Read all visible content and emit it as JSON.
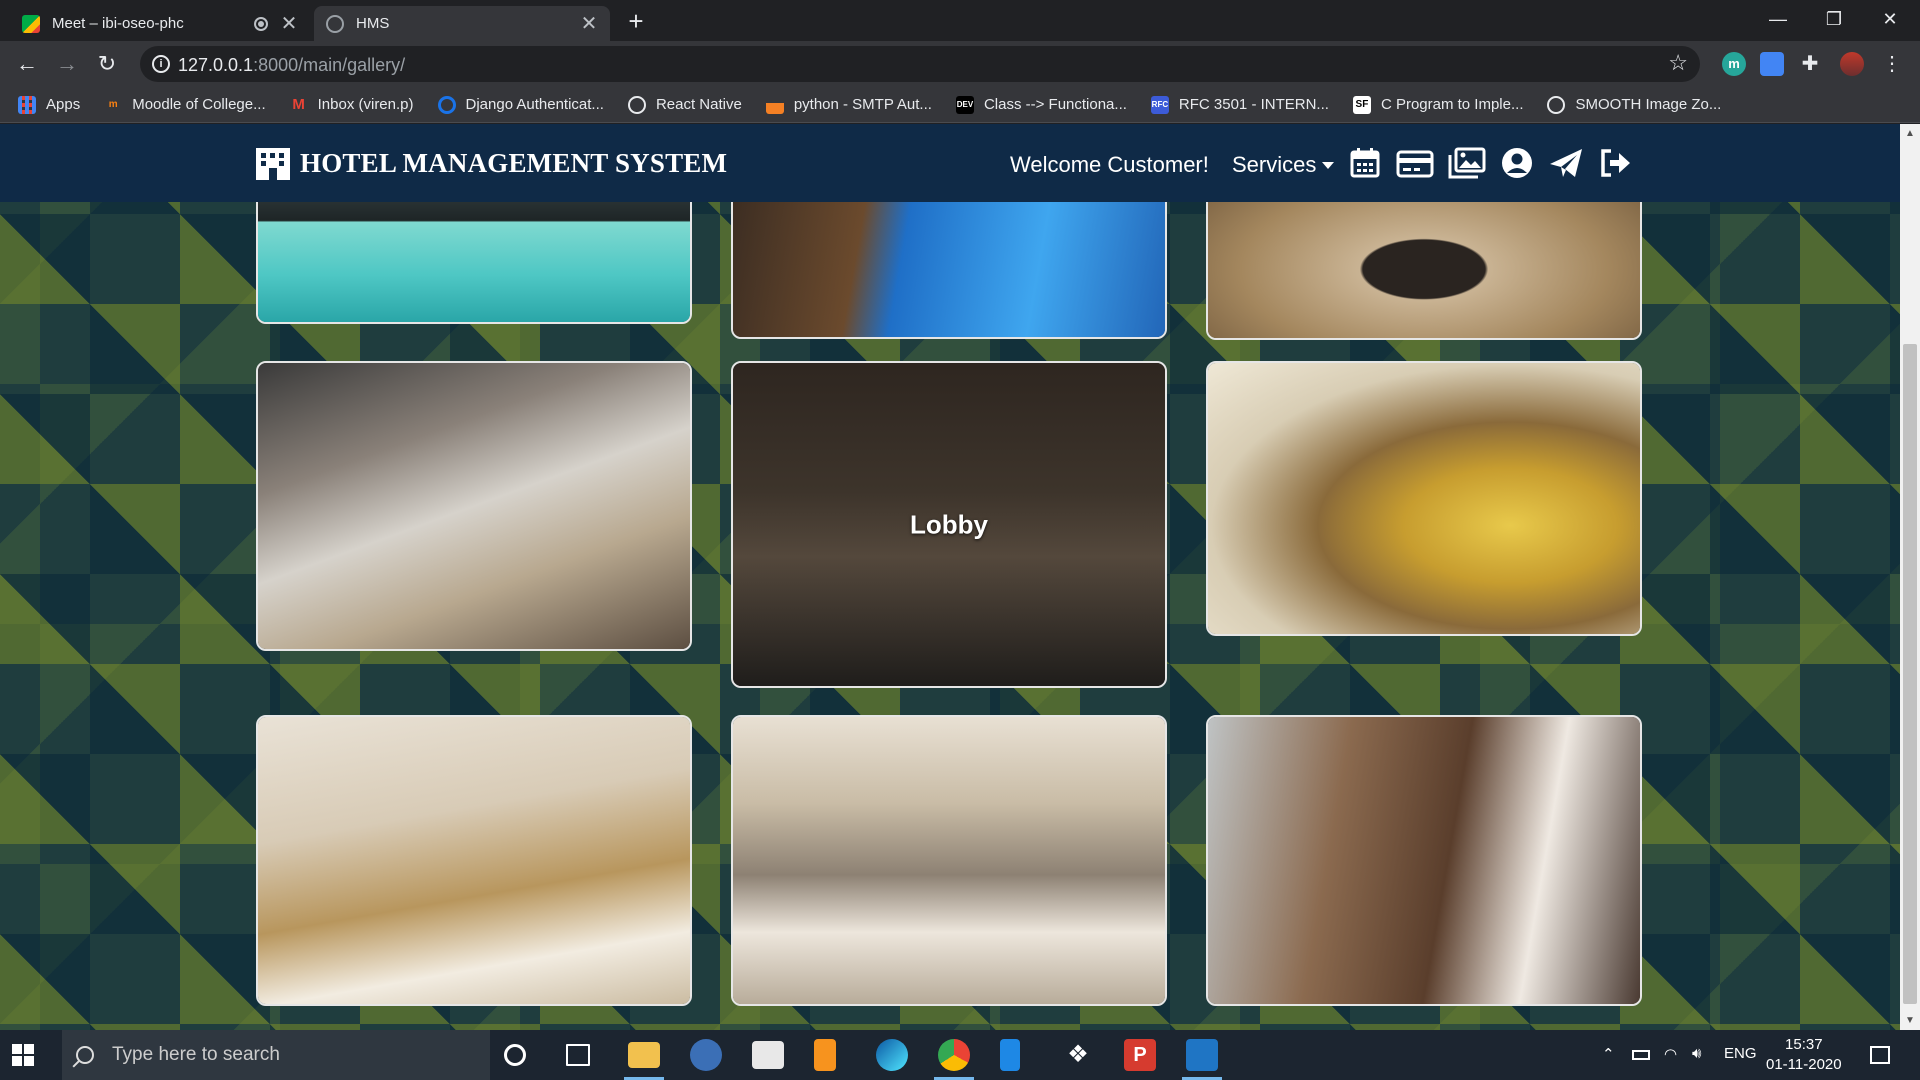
{
  "browser": {
    "tabs": [
      {
        "title": "Meet – ibi-oseo-phc",
        "active": false
      },
      {
        "title": "HMS",
        "active": true
      }
    ],
    "url_host": "127.0.0.1",
    "url_path": ":8000/main/gallery/",
    "bookmarks": [
      {
        "label": "Apps",
        "icon": "apps-grid-icon"
      },
      {
        "label": "Moodle of College...",
        "icon": "moodle-icon"
      },
      {
        "label": "Inbox (viren.p)",
        "icon": "gmail-icon"
      },
      {
        "label": "Django Authenticat...",
        "icon": "django-icon"
      },
      {
        "label": "React Native",
        "icon": "globe-icon"
      },
      {
        "label": "python - SMTP Aut...",
        "icon": "stackoverflow-icon"
      },
      {
        "label": "Class --> Functiona...",
        "icon": "dev-icon"
      },
      {
        "label": "RFC 3501 - INTERN...",
        "icon": "rfc-icon"
      },
      {
        "label": "C Program to Imple...",
        "icon": "sf-icon"
      },
      {
        "label": "SMOOTH Image Zo...",
        "icon": "globe-icon"
      }
    ]
  },
  "app": {
    "brand": "HOTEL MANAGEMENT SYSTEM",
    "welcome": "Welcome Customer!",
    "services_label": "Services",
    "nav_icons": [
      "calendar-icon",
      "credit-card-icon",
      "gallery-icon",
      "user-circle-icon",
      "paper-plane-icon",
      "logout-icon"
    ],
    "navbar_color": "#0f2a47"
  },
  "gallery": {
    "items": [
      {
        "name": "pool-1",
        "caption": ""
      },
      {
        "name": "pool-2",
        "caption": ""
      },
      {
        "name": "dining-hall",
        "caption": ""
      },
      {
        "name": "buffet",
        "caption": ""
      },
      {
        "name": "lobby",
        "caption": "Lobby"
      },
      {
        "name": "reception",
        "caption": ""
      },
      {
        "name": "bedroom-1",
        "caption": ""
      },
      {
        "name": "bedroom-2",
        "caption": ""
      },
      {
        "name": "bedroom-3",
        "caption": ""
      }
    ]
  },
  "taskbar": {
    "search_placeholder": "Type here to search",
    "language": "ENG",
    "time": "15:37",
    "date": "01-11-2020"
  }
}
